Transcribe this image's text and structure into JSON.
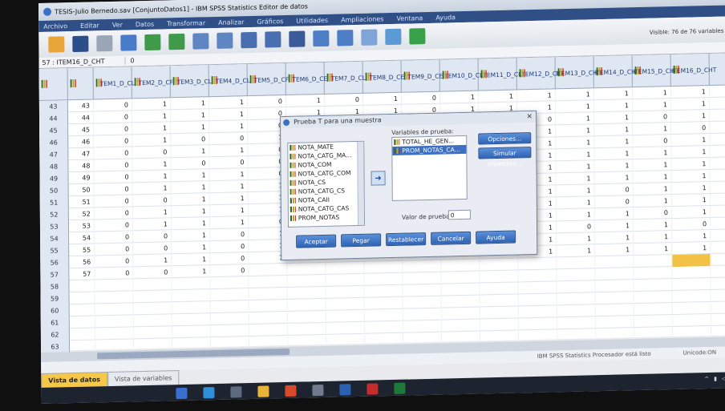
{
  "window": {
    "title": "TESIS-Julio Bernedo.sav [ConjuntoDatos1] - IBM SPSS Statistics Editor de datos"
  },
  "menu": [
    "Archivo",
    "Editar",
    "Ver",
    "Datos",
    "Transformar",
    "Analizar",
    "Gráficos",
    "Utilidades",
    "Ampliaciones",
    "Ventana",
    "Ayuda"
  ],
  "toolbar": {
    "visible_info": "Visible: 76 de 76 variables"
  },
  "cell_editor": {
    "name": "57 : ITEM16_D_CHT",
    "value": "0"
  },
  "columns": [
    "ITEM1_D_CL",
    "ITEM2_D_CF",
    "ITEM3_D_CL",
    "ITEM4_D_CL",
    "ITEM5_D_CF",
    "ITEM6_D_CE",
    "ITEM7_D_CL",
    "ITEM8_D_CE",
    "ITEM9_D_CE",
    "ITEM10_D_CL",
    "ITEM11_D_CL",
    "ITEM12_D_CL",
    "ITEM13_D_CHT",
    "ITEM14_D_CHT",
    "ITEM15_D_CHT",
    "ITEM16_D_CHT"
  ],
  "rows": [
    {
      "num": "43",
      "id": "43",
      "vals": [
        "0",
        "1",
        "1",
        "1",
        "0",
        "1",
        "0",
        "1",
        "0",
        "1",
        "1",
        "1",
        "1",
        "1",
        "1",
        "1"
      ]
    },
    {
      "num": "44",
      "id": "44",
      "vals": [
        "0",
        "1",
        "1",
        "1",
        "0",
        "1",
        "1",
        "1",
        "0",
        "1",
        "1",
        "1",
        "1",
        "1",
        "1",
        "1"
      ]
    },
    {
      "num": "45",
      "id": "45",
      "vals": [
        "0",
        "1",
        "1",
        "1",
        "0",
        "1",
        "1",
        "0",
        "1",
        "1",
        "1",
        "0",
        "1",
        "1",
        "0",
        "1"
      ]
    },
    {
      "num": "46",
      "id": "46",
      "vals": [
        "0",
        "1",
        "0",
        "0",
        "1",
        "1",
        "1",
        "1",
        "0",
        "1",
        "0",
        "1",
        "1",
        "1",
        "1",
        "0"
      ]
    },
    {
      "num": "47",
      "id": "47",
      "vals": [
        "0",
        "0",
        "1",
        "1",
        "0",
        "1",
        "1",
        "1",
        "0",
        "1",
        "1",
        "1",
        "1",
        "1",
        "0",
        "1"
      ]
    },
    {
      "num": "48",
      "id": "48",
      "vals": [
        "0",
        "1",
        "0",
        "0",
        "0",
        "1",
        "1",
        "1",
        "0",
        "1",
        "1",
        "1",
        "1",
        "1",
        "1",
        "1"
      ]
    },
    {
      "num": "49",
      "id": "49",
      "vals": [
        "0",
        "1",
        "1",
        "1",
        "0",
        "1",
        "1",
        "1",
        "0",
        "1",
        "1",
        "1",
        "1",
        "1",
        "1",
        "1"
      ]
    },
    {
      "num": "50",
      "id": "50",
      "vals": [
        "0",
        "1",
        "1",
        "1",
        "1",
        "1",
        "1",
        "1",
        "0",
        "1",
        "1",
        "1",
        "1",
        "1",
        "1",
        "1"
      ]
    },
    {
      "num": "51",
      "id": "51",
      "vals": [
        "0",
        "0",
        "1",
        "1",
        "1",
        "1",
        "1",
        "1",
        "0",
        "1",
        "1",
        "1",
        "1",
        "0",
        "1",
        "1"
      ]
    },
    {
      "num": "52",
      "id": "52",
      "vals": [
        "0",
        "1",
        "1",
        "1",
        "1",
        "1",
        "1",
        "1",
        "0",
        "1",
        "1",
        "1",
        "1",
        "0",
        "1",
        "1"
      ]
    },
    {
      "num": "53",
      "id": "53",
      "vals": [
        "0",
        "1",
        "1",
        "1",
        "0",
        "1",
        "1",
        "1",
        "0",
        "1",
        "1",
        "1",
        "1",
        "1",
        "0",
        "1"
      ]
    },
    {
      "num": "54",
      "id": "54",
      "vals": [
        "0",
        "0",
        "1",
        "0",
        "1",
        "1",
        "1",
        "1",
        "0",
        "1",
        "1",
        "1",
        "0",
        "1",
        "1",
        "0"
      ]
    },
    {
      "num": "55",
      "id": "55",
      "vals": [
        "0",
        "0",
        "1",
        "0",
        "1",
        "1",
        "1",
        "1",
        "0",
        "1",
        "1",
        "1",
        "1",
        "1",
        "1",
        "1"
      ]
    },
    {
      "num": "56",
      "id": "56",
      "vals": [
        "0",
        "1",
        "1",
        "0",
        "1",
        "0",
        "1",
        "1",
        "1",
        "1",
        "1",
        "1",
        "1",
        "1",
        "1",
        "1"
      ]
    },
    {
      "num": "57",
      "id": "57",
      "vals": [
        "0",
        "0",
        "1",
        "0",
        "",
        "",
        "",
        "",
        "",
        "",
        "",
        "",
        "",
        "",
        "",
        ""
      ]
    },
    {
      "num": "58",
      "id": "",
      "vals": []
    },
    {
      "num": "59",
      "id": "",
      "vals": []
    },
    {
      "num": "60",
      "id": "",
      "vals": []
    },
    {
      "num": "61",
      "id": "",
      "vals": []
    },
    {
      "num": "62",
      "id": "",
      "vals": []
    },
    {
      "num": "63",
      "id": "",
      "vals": []
    }
  ],
  "status": {
    "processor": "IBM SPSS Statistics Procesador está listo",
    "encoding": "Unicode:ON"
  },
  "tabs": {
    "data_view": "Vista de datos",
    "variable_view": "Vista de variables"
  },
  "dialog": {
    "title": "Prueba T para una muestra",
    "source_vars": [
      "NOTA_MATE",
      "NOTA_CATG_MA...",
      "NOTA_COM",
      "NOTA_CATG_COM",
      "NOTA_CS",
      "NOTA_CATG_CS",
      "NOTA_CAII",
      "NOTA_CATG_CAS",
      "PROM_NOTAS"
    ],
    "test_vars_label": "Variables de prueba:",
    "test_vars": [
      "TOTAL_HE_GEN...",
      "PROM_NOTAS_CA..."
    ],
    "options_btn": "Opciones...",
    "bootstrap_btn": "Simular muestreo...",
    "test_value_label": "Valor de prueba:",
    "test_value": "0",
    "accept": "Aceptar",
    "paste": "Pegar",
    "reset": "Restablecer",
    "cancel": "Cancelar",
    "help": "Ayuda"
  }
}
